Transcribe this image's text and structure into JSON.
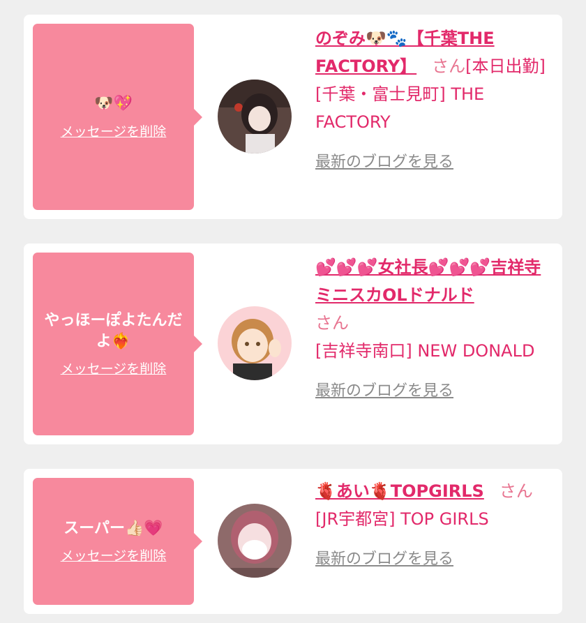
{
  "messages": [
    {
      "bubble_text": "🐶💖",
      "delete_label": "メッセージを削除",
      "girl_name": "のぞみ🐶🐾【千葉THE FACTORY】",
      "honorific": "さん",
      "status": "[本日出勤]",
      "shop": "[千葉・富士見町] THE FACTORY",
      "blog_label": "最新のブログを見る"
    },
    {
      "bubble_text": "やっほーぽよたんだよ❤️‍🔥",
      "delete_label": "メッセージを削除",
      "girl_name": "💕💕💕女社長💕💕💕吉祥寺ミニスカOLドナルド",
      "honorific": "さん",
      "status": "",
      "shop": "[吉祥寺南口] NEW DONALD",
      "blog_label": "最新のブログを見る"
    },
    {
      "bubble_text": "スーパー👍🏻💗",
      "delete_label": "メッセージを削除",
      "girl_name": "🫀あい🫀TOPGIRLS",
      "honorific": "さん",
      "status": "",
      "shop": "[JR宇都宮] TOP GIRLS",
      "blog_label": "最新のブログを見る"
    }
  ],
  "colors": {
    "accent": "#e2296a",
    "bubble": "#f7899d",
    "link_gray": "#8a8a8a",
    "background": "#efefef"
  }
}
